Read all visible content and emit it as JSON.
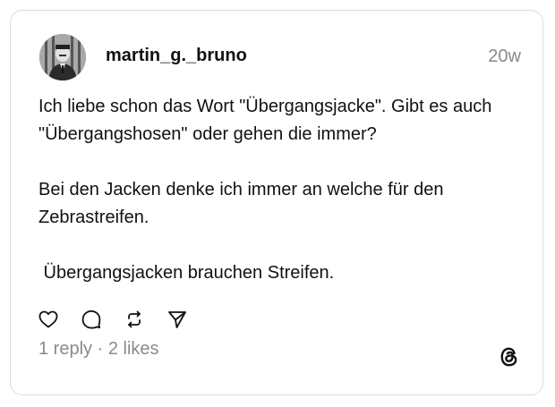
{
  "post": {
    "username": "martin_g._bruno",
    "timestamp": "20w",
    "paragraphs": [
      "Ich liebe schon das Wort \"Übergangsjacke\". Gibt es auch \"Übergangshosen\" oder gehen die immer?",
      "Bei den Jacken denke ich immer an welche für den Zebrastreifen.",
      " Übergangsjacken brauchen Streifen."
    ],
    "replies": "1 reply",
    "separator": "·",
    "likes": "2 likes"
  },
  "icons": {
    "like": "heart-icon",
    "reply": "comment-bubble-icon",
    "repost": "repost-icon",
    "share": "send-icon",
    "brand": "threads-logo-icon"
  },
  "colors": {
    "text": "#111111",
    "muted": "#8a8a8a",
    "border": "#dcdcdc",
    "background": "#ffffff"
  }
}
